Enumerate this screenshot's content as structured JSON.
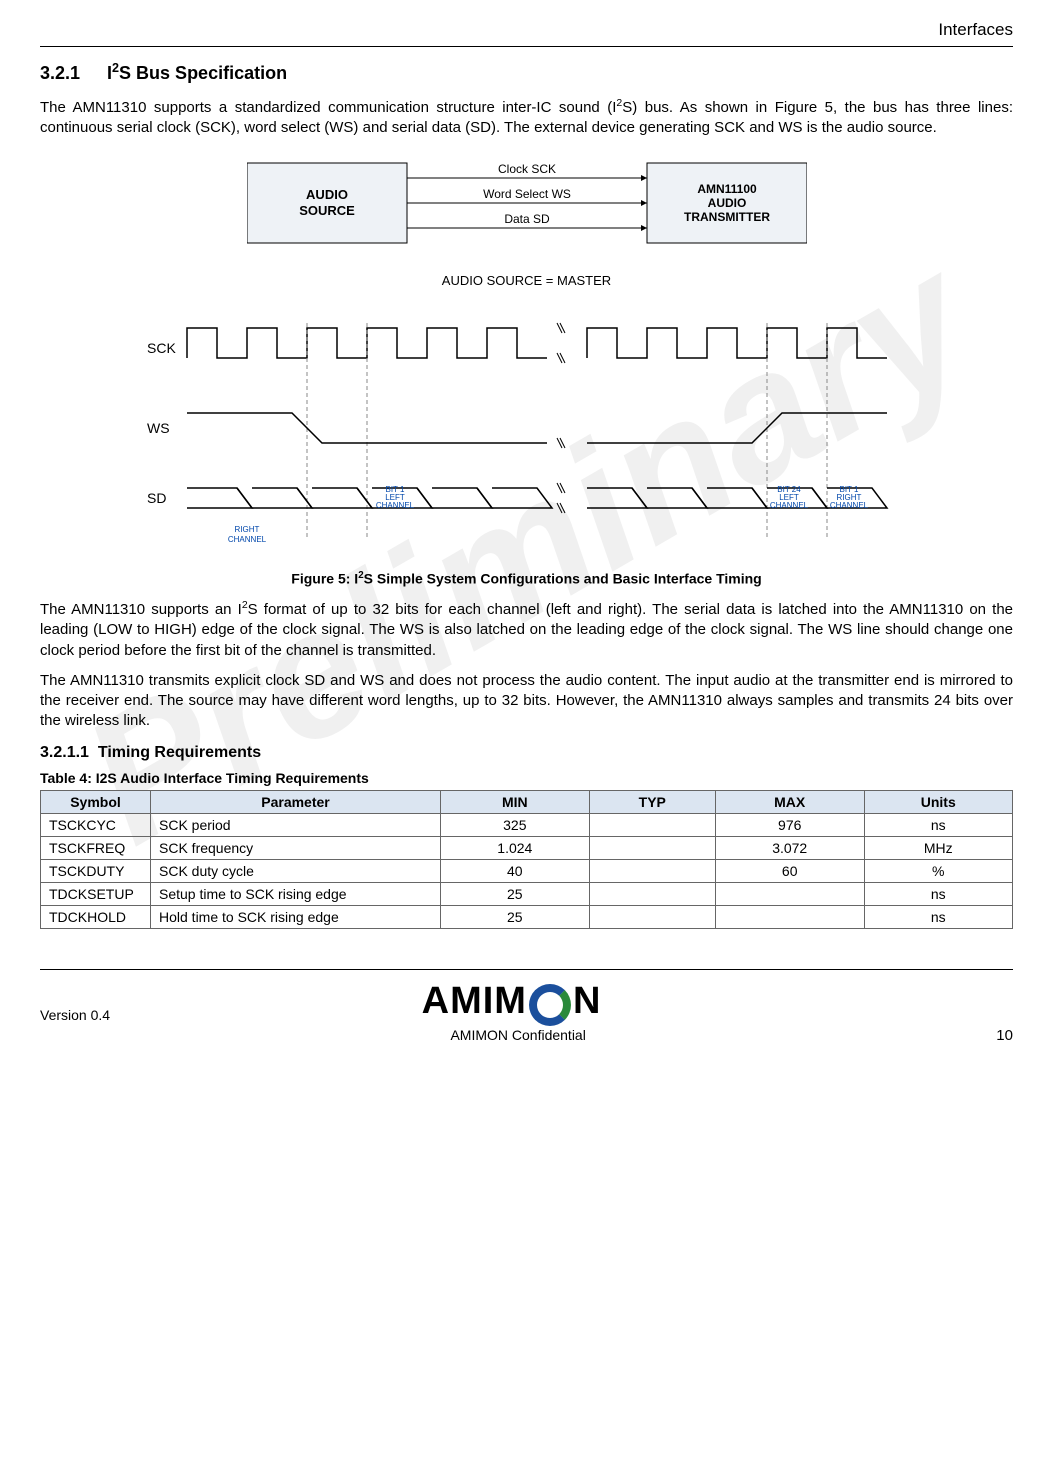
{
  "header": {
    "section": "Interfaces"
  },
  "watermark": "Preliminary",
  "heading": {
    "number": "3.2.1",
    "title_prefix": "I",
    "title_sup": "2",
    "title_suffix": "S Bus Specification"
  },
  "para1_a": "The AMN11310 supports a standardized communication structure inter-IC sound (I",
  "para1_sup": "2",
  "para1_b": "S) bus. As shown in Figure 5, the bus has three lines: continuous serial clock (SCK), word select (WS) and serial data (SD). The external device generating SCK and WS is the audio source.",
  "block_diagram": {
    "left_box_line1": "AUDIO",
    "left_box_line2": "SOURCE",
    "right_box_line1": "AMN11100",
    "right_box_line2": "AUDIO",
    "right_box_line3": "TRANSMITTER",
    "signals": {
      "clk": "Clock SCK",
      "ws": "Word Select WS",
      "sd": "Data SD"
    },
    "caption": "AUDIO SOURCE = MASTER"
  },
  "timing": {
    "labels": {
      "sck": "SCK",
      "ws": "WS",
      "sd": "SD"
    },
    "bits": {
      "right_ch_below": "RIGHT CHANNEL",
      "bit1_left_l1": "BIT 1",
      "bit1_left_l2": "LEFT",
      "bit1_left_l3": "CHANNEL",
      "bit24_left_l1": "BIT 24",
      "bit24_left_l2": "LEFT",
      "bit24_left_l3": "CHANNEL",
      "bit1_right_l1": "BIT 1",
      "bit1_right_l2": "RIGHT",
      "bit1_right_l3": "CHANNEL"
    }
  },
  "figure_caption_a": "Figure 5: I",
  "figure_caption_sup": "2",
  "figure_caption_b": "S Simple System Configurations and Basic Interface Timing",
  "para2_a": "The AMN11310 supports an I",
  "para2_sup": "2",
  "para2_b": "S format of up to 32 bits for each channel (left and right). The serial data is latched into the AMN11310 on the leading (LOW to HIGH) edge of the clock signal. The WS is also latched on the leading edge of the clock signal. The WS line should change one clock period before the first bit of the channel is transmitted.",
  "para3": "The AMN11310 transmits explicit clock SD and WS and does not process the audio content. The input audio at the transmitter end is mirrored to the receiver end. The source may have different word lengths, up to 32 bits. However, the AMN11310 always samples and transmits 24 bits over the wireless link.",
  "subheading": {
    "number": "3.2.1.1",
    "title": "Timing Requirements"
  },
  "table": {
    "title": "Table 4: I2S Audio Interface Timing Requirements",
    "headers": [
      "Symbol",
      "Parameter",
      "MIN",
      "TYP",
      "MAX",
      "Units"
    ],
    "rows": [
      {
        "symbol": "TSCKCYC",
        "parameter": "SCK period",
        "min": "325",
        "typ": "",
        "max": "976",
        "units": "ns"
      },
      {
        "symbol": "TSCKFREQ",
        "parameter": "SCK frequency",
        "min": "1.024",
        "typ": "",
        "max": "3.072",
        "units": "MHz"
      },
      {
        "symbol": "TSCKDUTY",
        "parameter": "SCK duty cycle",
        "min": "40",
        "typ": "",
        "max": "60",
        "units": "%"
      },
      {
        "symbol": "TDCKSETUP",
        "parameter": "Setup time to SCK rising edge",
        "min": "25",
        "typ": "",
        "max": "",
        "units": "ns"
      },
      {
        "symbol": "TDCKHOLD",
        "parameter": "Hold time to SCK rising edge",
        "min": "25",
        "typ": "",
        "max": "",
        "units": "ns"
      }
    ]
  },
  "footer": {
    "version": "Version 0.4",
    "logo_text_left": "AMIM",
    "logo_text_right": "N",
    "confidential": "AMIMON Confidential",
    "page": "10"
  }
}
